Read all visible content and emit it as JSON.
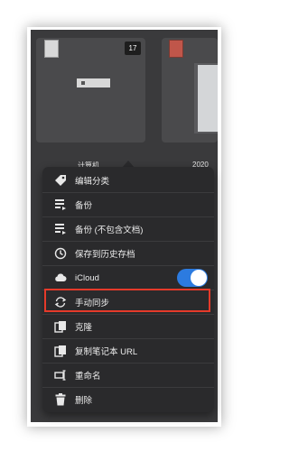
{
  "notebooks": [
    {
      "title": "计算机",
      "count": "17"
    },
    {
      "title": "2020"
    }
  ],
  "more_dots": "•••",
  "menu": {
    "items": [
      {
        "label": "编辑分类",
        "icon": "tag-icon"
      },
      {
        "label": "备份",
        "icon": "backup-icon"
      },
      {
        "label": "备份 (不包含文档)",
        "icon": "backup-no-docs-icon"
      },
      {
        "label": "保存到历史存档",
        "icon": "clock-icon"
      },
      {
        "label": "iCloud",
        "icon": "cloud-icon",
        "toggle": true
      },
      {
        "label": "手动同步",
        "icon": "sync-icon"
      },
      {
        "label": "克隆",
        "icon": "clone-icon"
      },
      {
        "label": "复制笔记本 URL",
        "icon": "copy-icon"
      },
      {
        "label": "重命名",
        "icon": "rename-icon"
      },
      {
        "label": "删除",
        "icon": "trash-icon"
      }
    ]
  },
  "colors": {
    "toggle_on": "#2c7be0",
    "highlight_border": "#e53a2a"
  }
}
